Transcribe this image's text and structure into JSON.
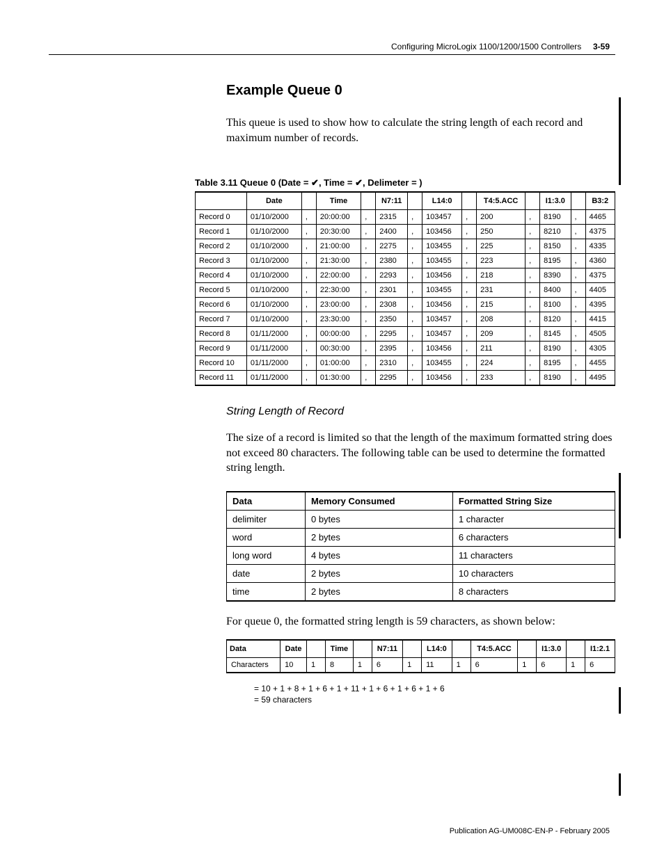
{
  "header": {
    "chapter": "Configuring MicroLogix 1100/1200/1500 Controllers",
    "page": "3-59"
  },
  "title": "Example Queue 0",
  "intro": "This queue is used to show how to calculate the string length of each record and maximum number of records.",
  "table_caption": {
    "prefix": "Table 3.11 Queue 0 (Date = ",
    "check1": "✔",
    "mid1": ", Time = ",
    "check2": "✔",
    "mid2": ", Delimeter = )"
  },
  "queue_headers": [
    "",
    "Date",
    "",
    "Time",
    "",
    "N7:11",
    "",
    "L14:0",
    "",
    "T4:5.ACC",
    "",
    "I1:3.0",
    "",
    "B3:2"
  ],
  "queue_rows": [
    [
      "Record 0",
      "01/10/2000",
      ",",
      "20:00:00",
      ",",
      "2315",
      ",",
      "103457",
      ",",
      "200",
      ",",
      "8190",
      ",",
      "4465"
    ],
    [
      "Record 1",
      "01/10/2000",
      ",",
      "20:30:00",
      ",",
      "2400",
      ",",
      "103456",
      ",",
      "250",
      ",",
      "8210",
      ",",
      "4375"
    ],
    [
      "Record 2",
      "01/10/2000",
      ",",
      "21:00:00",
      ",",
      "2275",
      ",",
      "103455",
      ",",
      "225",
      ",",
      "8150",
      ",",
      "4335"
    ],
    [
      "Record 3",
      "01/10/2000",
      ",",
      "21:30:00",
      ",",
      "2380",
      ",",
      "103455",
      ",",
      "223",
      ",",
      "8195",
      ",",
      "4360"
    ],
    [
      "Record 4",
      "01/10/2000",
      ",",
      "22:00:00",
      ",",
      "2293",
      ",",
      "103456",
      ",",
      "218",
      ",",
      "8390",
      ",",
      "4375"
    ],
    [
      "Record 5",
      "01/10/2000",
      ",",
      "22:30:00",
      ",",
      "2301",
      ",",
      "103455",
      ",",
      "231",
      ",",
      "8400",
      ",",
      "4405"
    ],
    [
      "Record 6",
      "01/10/2000",
      ",",
      "23:00:00",
      ",",
      "2308",
      ",",
      "103456",
      ",",
      "215",
      ",",
      "8100",
      ",",
      "4395"
    ],
    [
      "Record 7",
      "01/10/2000",
      ",",
      "23:30:00",
      ",",
      "2350",
      ",",
      "103457",
      ",",
      "208",
      ",",
      "8120",
      ",",
      "4415"
    ],
    [
      "Record 8",
      "01/11/2000",
      ",",
      "00:00:00",
      ",",
      "2295",
      ",",
      "103457",
      ",",
      "209",
      ",",
      "8145",
      ",",
      "4505"
    ],
    [
      "Record 9",
      "01/11/2000",
      ",",
      "00:30:00",
      ",",
      "2395",
      ",",
      "103456",
      ",",
      "211",
      ",",
      "8190",
      ",",
      "4305"
    ],
    [
      "Record 10",
      "01/11/2000",
      ",",
      "01:00:00",
      ",",
      "2310",
      ",",
      "103455",
      ",",
      "224",
      ",",
      "8195",
      ",",
      "4455"
    ],
    [
      "Record 11",
      "01/11/2000",
      ",",
      "01:30:00",
      ",",
      "2295",
      ",",
      "103456",
      ",",
      "233",
      ",",
      "8190",
      ",",
      "4495"
    ]
  ],
  "subheading": "String Length of Record",
  "sub_intro": "The size of a record is limited so that the length of the maximum formatted string does not exceed 80 characters. The following table can be used to determine the formatted string length.",
  "mem_headers": [
    "Data",
    "Memory Consumed",
    "Formatted String Size"
  ],
  "mem_rows": [
    [
      "delimiter",
      "0 bytes",
      "1 character"
    ],
    [
      "word",
      "2 bytes",
      "6 characters"
    ],
    [
      "long word",
      "4 bytes",
      "11 characters"
    ],
    [
      "date",
      "2 bytes",
      "10 characters"
    ],
    [
      "time",
      "2 bytes",
      "8 characters"
    ]
  ],
  "after_mem": "For queue 0, the formatted string length is 59 characters, as shown below:",
  "chars_headers": [
    "Data",
    "Date",
    "",
    "Time",
    "",
    "N7:11",
    "",
    "L14:0",
    "",
    "T4:5.ACC",
    "",
    "I1:3.0",
    "",
    "I1:2.1"
  ],
  "chars_row": [
    "Characters",
    "10",
    "1",
    "8",
    "1",
    "6",
    "1",
    "11",
    "1",
    "6",
    "1",
    "6",
    "1",
    "6"
  ],
  "eq1": "= 10 + 1 + 8 + 1 + 6 + 1 + 11 + 1 + 6 + 1 + 6 + 1 + 6",
  "eq2": "= 59 characters",
  "footer": "Publication AG-UM008C-EN-P - February 2005"
}
